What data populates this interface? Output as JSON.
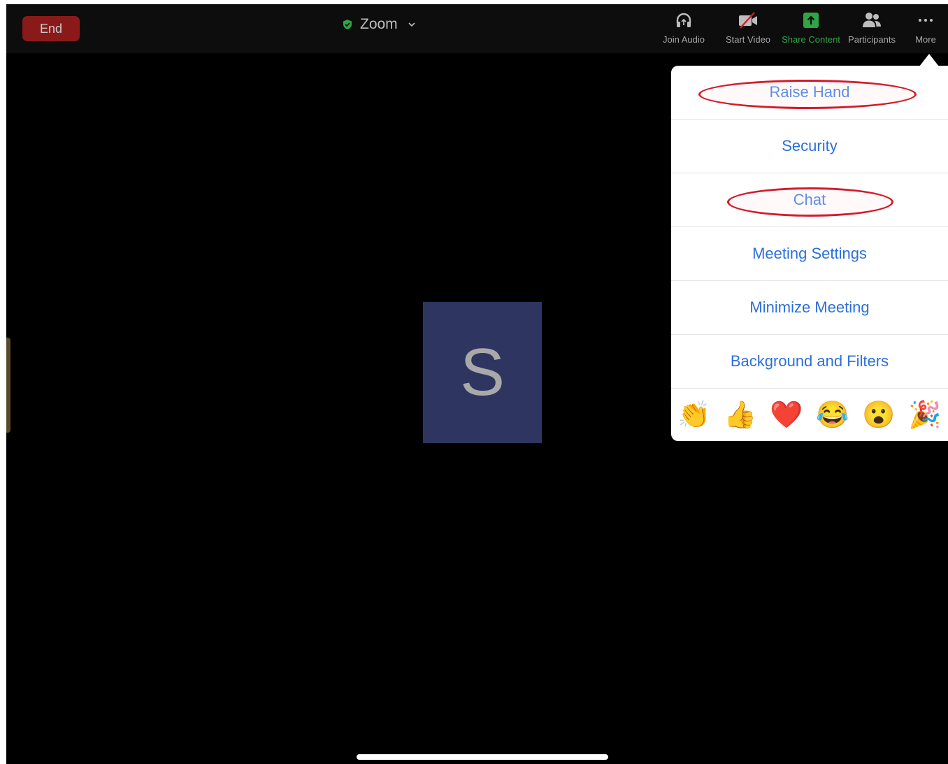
{
  "toolbar": {
    "end_label": "End",
    "meeting_title": "Zoom",
    "join_audio_label": "Join Audio",
    "start_video_label": "Start Video",
    "share_content_label": "Share Content",
    "participants_label": "Participants",
    "more_label": "More"
  },
  "participant": {
    "initial": "S"
  },
  "more_menu": {
    "items": [
      {
        "label": "Raise Hand"
      },
      {
        "label": "Security"
      },
      {
        "label": "Chat"
      },
      {
        "label": "Meeting Settings"
      },
      {
        "label": "Minimize Meeting"
      },
      {
        "label": "Background and Filters"
      }
    ],
    "reactions": [
      {
        "emoji": "👏",
        "icon": "clapping-hands-icon"
      },
      {
        "emoji": "👍",
        "icon": "thumbs-up-icon"
      },
      {
        "emoji": "❤️",
        "icon": "heart-icon"
      },
      {
        "emoji": "😂",
        "icon": "tears-of-joy-icon"
      },
      {
        "emoji": "😮",
        "icon": "surprised-face-icon"
      },
      {
        "emoji": "🎉",
        "icon": "party-popper-icon"
      }
    ]
  },
  "colors": {
    "accent_blue": "#2c6fdc",
    "end_red": "#8a1a1a",
    "share_green": "#2fa546",
    "highlight_red": "#d41b2c",
    "avatar_bg": "#2e3560"
  }
}
